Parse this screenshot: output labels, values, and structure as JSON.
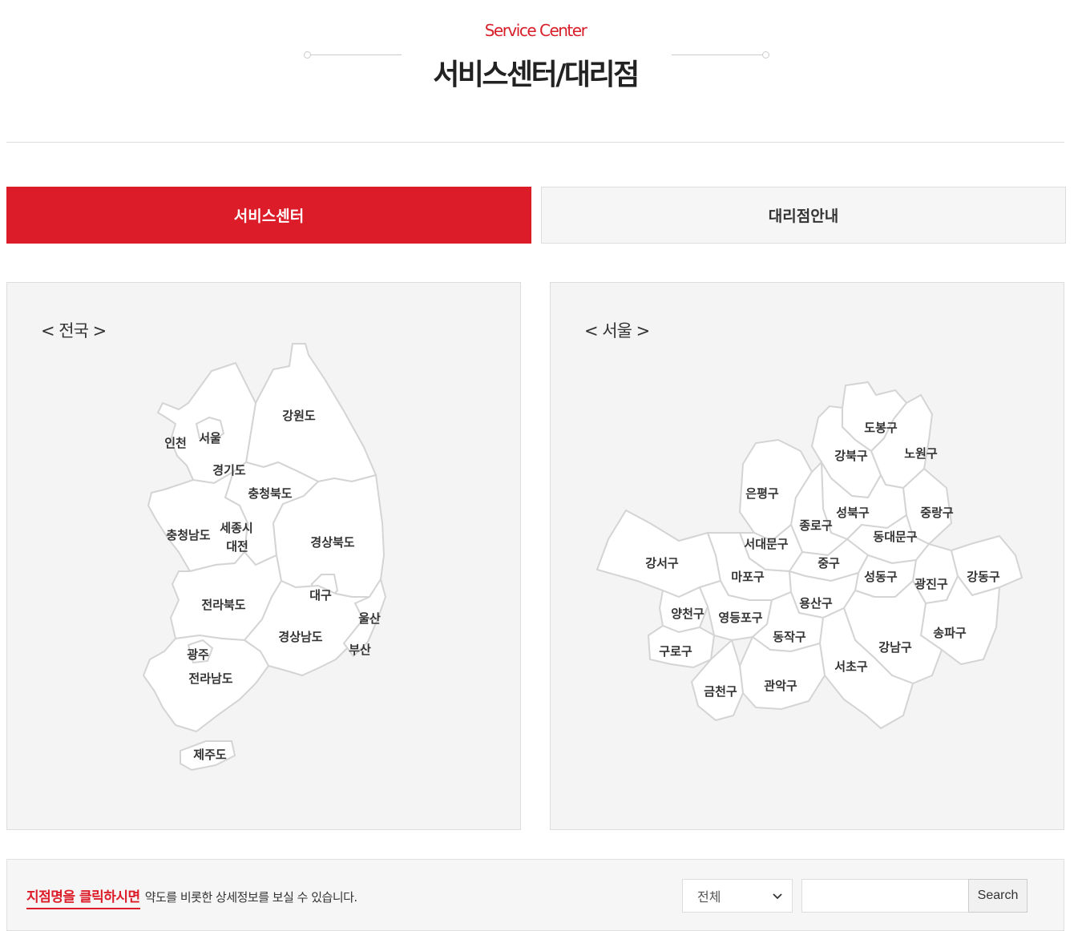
{
  "header": {
    "subtitle": "Service Center",
    "title": "서비스센터/대리점"
  },
  "tabs": [
    {
      "label": "서비스센터",
      "active": true
    },
    {
      "label": "대리점안내",
      "active": false
    }
  ],
  "colors": {
    "accent": "#dc1c28",
    "panel_bg": "#f4f4f4"
  },
  "national_map": {
    "title": "< 전국 >",
    "regions": [
      "강원도",
      "인천",
      "서울",
      "경기도",
      "충청북도",
      "충청남도",
      "세종시",
      "대전",
      "경상북도",
      "대구",
      "울산",
      "전라북도",
      "경상남도",
      "부산",
      "광주",
      "전라남도",
      "제주도"
    ]
  },
  "seoul_map": {
    "title": "< 서울 >",
    "districts": [
      "도봉구",
      "강북구",
      "노원구",
      "은평구",
      "성북구",
      "중랑구",
      "종로구",
      "동대문구",
      "서대문구",
      "강서구",
      "중구",
      "마포구",
      "성동구",
      "광진구",
      "강동구",
      "용산구",
      "양천구",
      "영등포구",
      "송파구",
      "동작구",
      "구로구",
      "강남구",
      "서초구",
      "관악구",
      "금천구"
    ]
  },
  "search": {
    "notice_em": "지점명을 클릭하시면",
    "notice_text": "약도를 비롯한 상세정보를 보실 수 있습니다.",
    "select_value": "전체",
    "input_value": "",
    "button_label": "Search"
  }
}
